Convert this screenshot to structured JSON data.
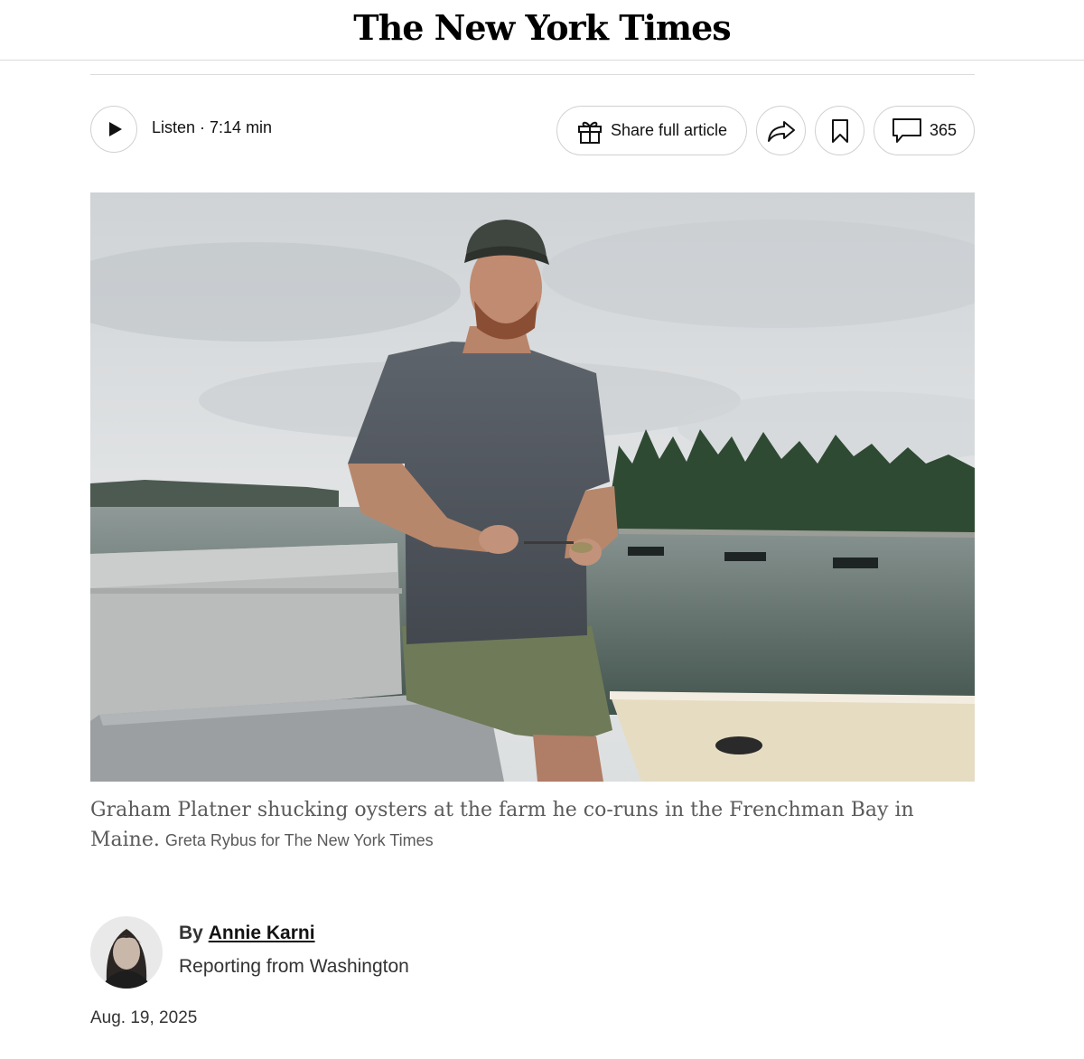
{
  "masthead": {
    "title": "The New York Times"
  },
  "toolbar": {
    "listen_label": "Listen · 7:14 min",
    "share_article_label": "Share full article",
    "comment_count": "365",
    "icons": [
      "play-icon",
      "gift-icon",
      "share-arrow-icon",
      "bookmark-icon",
      "comment-icon"
    ]
  },
  "photo": {
    "caption": "Graham Platner shucking oysters at the farm he co-runs in the Frenchman Bay in Maine.",
    "credit": "Greta Rybus for The New York Times"
  },
  "byline": {
    "prefix": "By",
    "author": "Annie Karni",
    "dateline": "Reporting from Washington"
  },
  "article": {
    "date": "Aug. 19, 2025"
  },
  "colors": {
    "text": "#121212",
    "caption": "#5a5a5a",
    "border": "#d0d0d0"
  }
}
